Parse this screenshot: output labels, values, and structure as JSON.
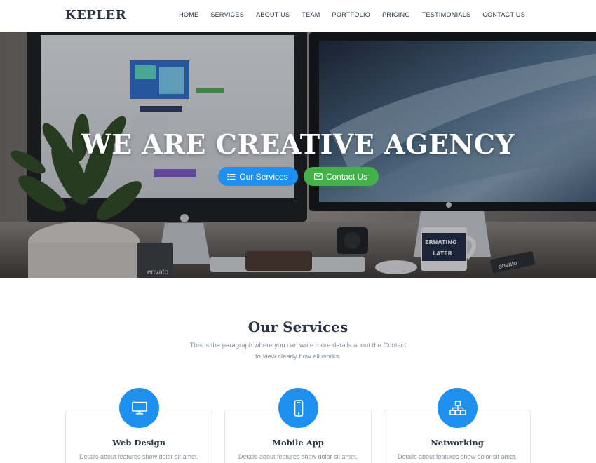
{
  "brand": "KEPLER",
  "nav": [
    "HOME",
    "SERVICES",
    "ABOUT US",
    "TEAM",
    "PORTFOLIO",
    "PRICING",
    "TESTIMONIALS",
    "CONTACT US"
  ],
  "hero": {
    "title": "WE ARE CREATIVE AGENCY",
    "primary_button": {
      "label": "Our Services",
      "icon": "list-icon",
      "color": "#1e90f0"
    },
    "secondary_button": {
      "label": "Contact Us",
      "icon": "envelope-icon",
      "color": "#43b04a"
    },
    "image_text": {
      "envato_left": "envato",
      "envato_right": "envato",
      "mug_line1": "ERNATING",
      "mug_line2": "LATER"
    }
  },
  "services": {
    "title": "Our Services",
    "subtitle_line1": "This is the paragraph where you can write more details about the Contact",
    "subtitle_line2": "to view clearly how all works.",
    "cards": [
      {
        "title": "Web Design",
        "text": "Details about features show dolor sit amet,",
        "icon": "monitor-icon"
      },
      {
        "title": "Mobile App",
        "text": "Details about features show dolor sit amet,",
        "icon": "mobile-icon"
      },
      {
        "title": "Networking",
        "text": "Details about features show dolor sit amet,",
        "icon": "network-icon"
      }
    ]
  },
  "colors": {
    "accent": "#1e90f0",
    "green": "#43b04a",
    "text": "#2c3345",
    "muted": "#8a8f99"
  }
}
